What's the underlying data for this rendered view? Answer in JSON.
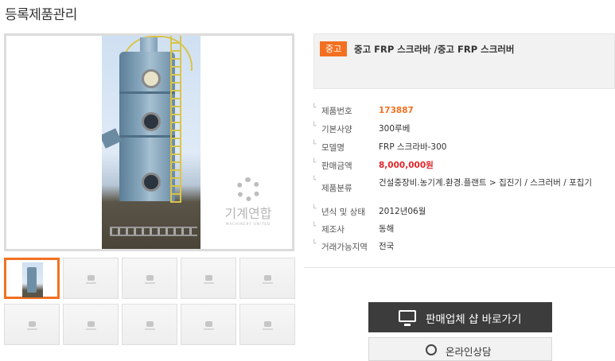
{
  "page": {
    "title": "등록제품관리"
  },
  "gallery": {
    "watermark_text": "기계연합",
    "watermark_sub": "MACHINERY UNITED",
    "thumbnail_count": 10,
    "active_index": 0
  },
  "product": {
    "badge": "중고",
    "title": "중고 FRP 스크라바 /중고 FRP 스크러버",
    "fields": [
      {
        "label": "제품번호",
        "value": "173887",
        "style": "orange"
      },
      {
        "label": "기본사양",
        "value": "300루베",
        "style": ""
      },
      {
        "label": "모델명",
        "value": "FRP 스크라바-300",
        "style": ""
      },
      {
        "label": "판매금액",
        "value": "8,000,000원",
        "style": "red"
      },
      {
        "label": "제품분류",
        "value": "건설중장비.농기계.환경.플랜트 > 집진기 / 스크러버 / 포집기",
        "style": ""
      },
      {
        "label": "년식 및 상태",
        "value": "2012년06월",
        "style": ""
      },
      {
        "label": "제조사",
        "value": "동해",
        "style": ""
      },
      {
        "label": "거래가능지역",
        "value": "전국",
        "style": ""
      }
    ]
  },
  "actions": {
    "shop_label": "판매업체 샵 바로가기",
    "consult_label": "온라인상담"
  },
  "colors": {
    "accent": "#f37021",
    "price": "#e0262b",
    "dark_button": "#3c3c3c"
  },
  "icons": {
    "shop": "monitor-icon",
    "consult": "headset-icon"
  }
}
